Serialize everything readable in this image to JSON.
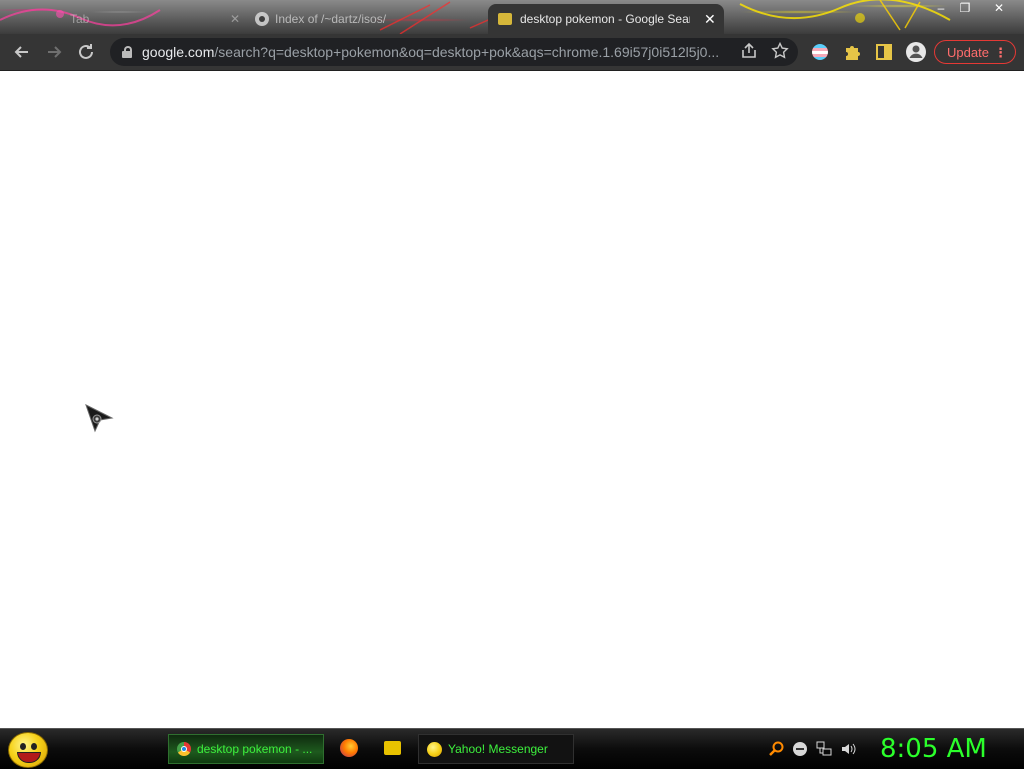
{
  "colors": {
    "toolbar_bg": "#353535",
    "omnibox_bg": "#202124",
    "update_red": "#e53935",
    "clock_green": "#2bff2b",
    "taskbar_text_green": "#3df03d"
  },
  "browser": {
    "tabs": [
      {
        "title": "Tab",
        "icon": "blank-tab-icon",
        "active": false
      },
      {
        "title": "Index of /~dartz/isos/",
        "icon": "globe-icon",
        "active": false
      },
      {
        "title": "desktop pokemon - Google Sear",
        "icon": "doc-icon",
        "active": true
      }
    ],
    "window_controls": {
      "minimize": "–",
      "maximize": "❐",
      "close": "✕"
    },
    "toolbar": {
      "back_icon": "arrow-left-icon",
      "forward_icon": "arrow-right-icon",
      "reload_icon": "reload-icon",
      "url_host": "google.com",
      "url_rest": "/search?q=desktop+pokemon&oq=desktop+pok&aqs=chrome.1.69i57j0i512l5j0...",
      "update_label": "Update"
    }
  },
  "taskbar": {
    "start_icon": "yahoo-smiley-icon",
    "items": [
      {
        "label": "desktop pokemon - ...",
        "icon": "chrome-icon",
        "active": true
      },
      {
        "label": "Yahoo! Messenger",
        "icon": "yahoo-smiley-icon",
        "active": false
      }
    ],
    "quick_launch": [
      "firefox-icon",
      "folder-icon"
    ],
    "tray_icons": [
      "search-icon",
      "minus-circle-icon",
      "network-icon",
      "volume-icon"
    ],
    "clock": "8:05 AM"
  }
}
